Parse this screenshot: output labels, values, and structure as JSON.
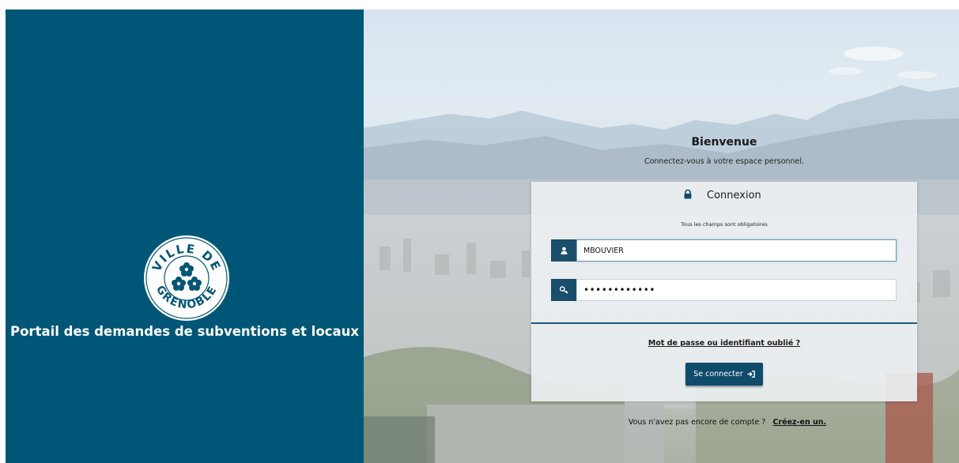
{
  "branding": {
    "logo_text_top": "VILLE DE",
    "logo_text_bottom": "GRENOBLE",
    "portal_title": "Portail des demandes de subventions et locaux"
  },
  "welcome": {
    "title": "Bienvenue",
    "subtitle": "Connectez-vous à votre espace personnel."
  },
  "login": {
    "title": "Connexion",
    "required_note": "Tous les champs sont obligatoires",
    "username_value": "MBOUVIER",
    "password_value": "azertyuiopqs",
    "forgot_link": "Mot de passe ou identifiant oublié ?",
    "submit_label": "Se connecter"
  },
  "signup": {
    "prompt": "Vous n'avez pas encore de compte ?",
    "link": "Créez-en un."
  },
  "icons": {
    "lock": "lock-icon",
    "user": "user-icon",
    "key": "key-icon",
    "sign_in": "sign-in-icon"
  },
  "colors": {
    "brand_blue": "#005676",
    "button_blue": "#0f4c6b",
    "addon_blue": "#1b4e6b"
  }
}
